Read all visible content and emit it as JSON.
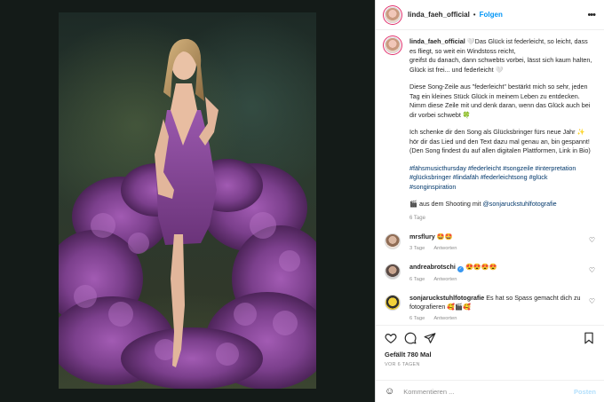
{
  "header": {
    "username": "linda_faeh_official",
    "separator": "•",
    "follow_label": "Folgen",
    "more_label": "•••"
  },
  "caption": {
    "username": "linda_faeh_official",
    "paragraphs": [
      "🤍Das Glück ist federleicht, so leicht, dass es fliegt, so weit ein Windstoss reicht,\ngreifst du danach, dann schwebts vorbei, lässt sich kaum halten, Glück ist frei... und federleicht 🤍",
      "Diese Song-Zeile aus \"federleicht\" bestärkt mich so sehr, jeden Tag ein kleines Stück Glück in meinem Leben zu entdecken. Nimm diese Zeile mit und denk daran, wenn das Glück auch bei dir vorbei schwebt 🍀",
      "Ich schenke dir den Song als Glücksbringer fürs neue Jahr ✨ hör dir das Lied und den Text dazu mal genau an, bin gespannt! (Den Song findest du auf allen digitalen Plattformen, Link in Bio)"
    ],
    "hashtags": "#fähsmusicthursday #federleicht #songzeile #interpretation #glücksbringer #lindafäh #federleichtsong #glück #songinspiration",
    "credit_prefix": "🎬 aus dem Shooting mit ",
    "credit_mention": "@sonjaruckstuhlfotografie",
    "age": "6 Tage"
  },
  "comments": [
    {
      "username": "mrsflury",
      "text": "🤩🤩",
      "age": "3 Tage",
      "reply": "Antworten",
      "verified": false
    },
    {
      "username": "andreabrotschi",
      "text": "😍😍😍😍",
      "age": "6 Tage",
      "reply": "Antworten",
      "verified": true
    },
    {
      "username": "sonjaruckstuhlfotografie",
      "text": "Es hat so Spass gemacht dich zu fotografieren 🥰🎬🥰",
      "age": "6 Tage",
      "reply": "Antworten",
      "verified": false
    }
  ],
  "actions": {
    "likes": "Gefällt 780 Mal",
    "date": "VOR 6 TAGEN"
  },
  "comment_box": {
    "placeholder": "Kommentieren ...",
    "post_label": "Posten",
    "emoji": "☺"
  },
  "icons": [
    "heart-icon",
    "comment-icon",
    "share-icon",
    "bookmark-icon",
    "emoji-icon",
    "more-icon"
  ],
  "colors": {
    "link": "#0095f6",
    "tag": "#00376b",
    "muted": "#8e8e8e",
    "gown": "#7b3f8c"
  }
}
